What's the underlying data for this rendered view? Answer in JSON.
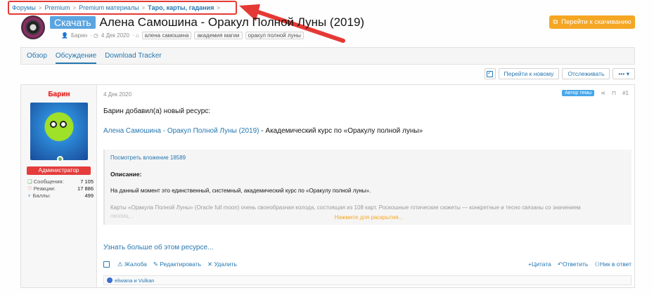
{
  "breadcrumb": {
    "items": [
      "Форумы",
      "Premium",
      "Premium материалы",
      "Тaро, карты, гадания"
    ],
    "sep": ">"
  },
  "header": {
    "badge": "Скачать",
    "title": "Алена Самошина - Оракул Полной Луны (2019)",
    "meta_author": "Барин",
    "meta_date": "4 Дек 2020",
    "tags": [
      "алена самошина",
      "академия магии",
      "оракул полной луны"
    ],
    "download_button": "Перейти к скачиванию"
  },
  "tabs": [
    "Обзор",
    "Обсуждение",
    "Download Tracker"
  ],
  "toolbar": {
    "goto_new": "Перейти к новому",
    "watch": "Отслеживать",
    "more": "•••"
  },
  "post": {
    "user": {
      "name": "Барин",
      "role": "Администратор",
      "stats": [
        {
          "label": "Сообщения:",
          "value": "7 105"
        },
        {
          "label": "Реакции:",
          "value": "17 886"
        },
        {
          "label": "Баллы:",
          "value": "499"
        }
      ]
    },
    "date": "4 Дек 2020",
    "author_badge": "Автор темы",
    "number": "#1",
    "intro": "Барин добавил(а) новый ресурс:",
    "resource_link": "Алена Самошина - Оракул Полной Луны (2019)",
    "resource_tail": " - Академический курс по «Оракулу полной луны»",
    "view_attachment": "Посмотреть вложение 18589",
    "description_label": "Описание:",
    "desc_p1": "На данный момент это единственный, системный, академический курс по «Оракулу полной луны».",
    "desc_p2": "Карты «Оракула Полной Луны» (Oracle full moon) очень своеобразная колода, состоящая из 108 карт. Роскошные готические сюжеты — конкретные и тесно связаны со значением",
    "desc_p2_fade": "пкопиц...",
    "expand": "Нажмите для раскрытия...",
    "more_link": "Узнать больше об этом ресурсе...",
    "actions_left": [
      "Жалоба",
      "Редактировать",
      "Удалить"
    ],
    "actions_right": [
      "Цитата",
      "Ответить",
      "Ник в ответ"
    ],
    "reactions": "eliwana и Vulkan"
  },
  "colors": {
    "accent": "#2577b1",
    "download": "#f5a623",
    "annotation": "#e53935"
  }
}
